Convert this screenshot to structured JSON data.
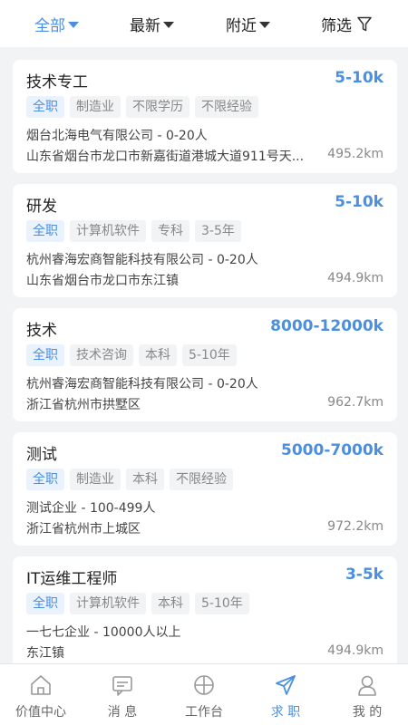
{
  "filters": [
    {
      "label": "全部",
      "active": true
    },
    {
      "label": "最新",
      "active": false
    },
    {
      "label": "附近",
      "active": false
    }
  ],
  "filter_button": {
    "label": "筛选",
    "icon": "funnel-icon"
  },
  "jobs": [
    {
      "title": "技术专工",
      "salary": "5-10k",
      "tags": [
        "全职",
        "制造业",
        "不限学历",
        "不限经验"
      ],
      "company": "烟台北海电气有限公司 - 0-20人",
      "address": "山东省烟台市龙口市新嘉街道港城大道911号天...",
      "distance": "495.2km"
    },
    {
      "title": "研发",
      "salary": "5-10k",
      "tags": [
        "全职",
        "计算机软件",
        "专科",
        "3-5年"
      ],
      "company": "杭州睿海宏商智能科技有限公司 - 0-20人",
      "address": "山东省烟台市龙口市东江镇",
      "distance": "494.9km"
    },
    {
      "title": "技术",
      "salary": "8000-12000k",
      "tags": [
        "全职",
        "技术咨询",
        "本科",
        "5-10年"
      ],
      "company": "杭州睿海宏商智能科技有限公司 - 0-20人",
      "address": "浙江省杭州市拱墅区",
      "distance": "962.7km"
    },
    {
      "title": "测试",
      "salary": "5000-7000k",
      "tags": [
        "全职",
        "制造业",
        "本科",
        "不限经验"
      ],
      "company": "测试企业 - 100-499人",
      "address": "浙江省杭州市上城区",
      "distance": "972.2km"
    },
    {
      "title": "IT运维工程师",
      "salary": "3-5k",
      "tags": [
        "全职",
        "计算机软件",
        "本科",
        "5-10年"
      ],
      "company": "一七七企业 - 10000人以上",
      "address": "东江镇",
      "distance": "494.9km"
    }
  ],
  "tabbar": [
    {
      "label": "价值中心",
      "icon": "home-icon",
      "active": false
    },
    {
      "label": "消 息",
      "icon": "message-icon",
      "active": false
    },
    {
      "label": "工作台",
      "icon": "workbench-icon",
      "active": false
    },
    {
      "label": "求 职",
      "icon": "send-icon",
      "active": true
    },
    {
      "label": "我 的",
      "icon": "user-icon",
      "active": false
    }
  ],
  "colors": {
    "accent": "#4a8fe0",
    "background": "#f2f3f5",
    "tag_bg": "#eaf2fd"
  }
}
